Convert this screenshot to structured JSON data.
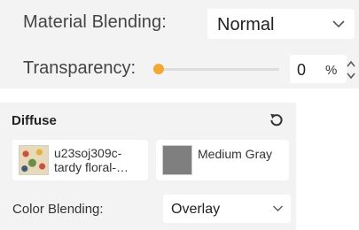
{
  "material_blending": {
    "label": "Material Blending:",
    "selected": "Normal",
    "chevron_icon": "chevron-down-icon"
  },
  "transparency": {
    "label": "Transparency:",
    "value": "0",
    "unit": "%",
    "slider_fraction": 0,
    "accent_color": "#f3a833"
  },
  "diffuse": {
    "title": "Diffuse",
    "reset_icon": "reset-icon",
    "texture": {
      "name": "u23soj309c-tardy floral-…"
    },
    "color": {
      "name": "Medium Gray",
      "swatch_color": "#7f7f7f"
    },
    "color_blending": {
      "label": "Color Blending:",
      "selected": "Overlay"
    }
  }
}
